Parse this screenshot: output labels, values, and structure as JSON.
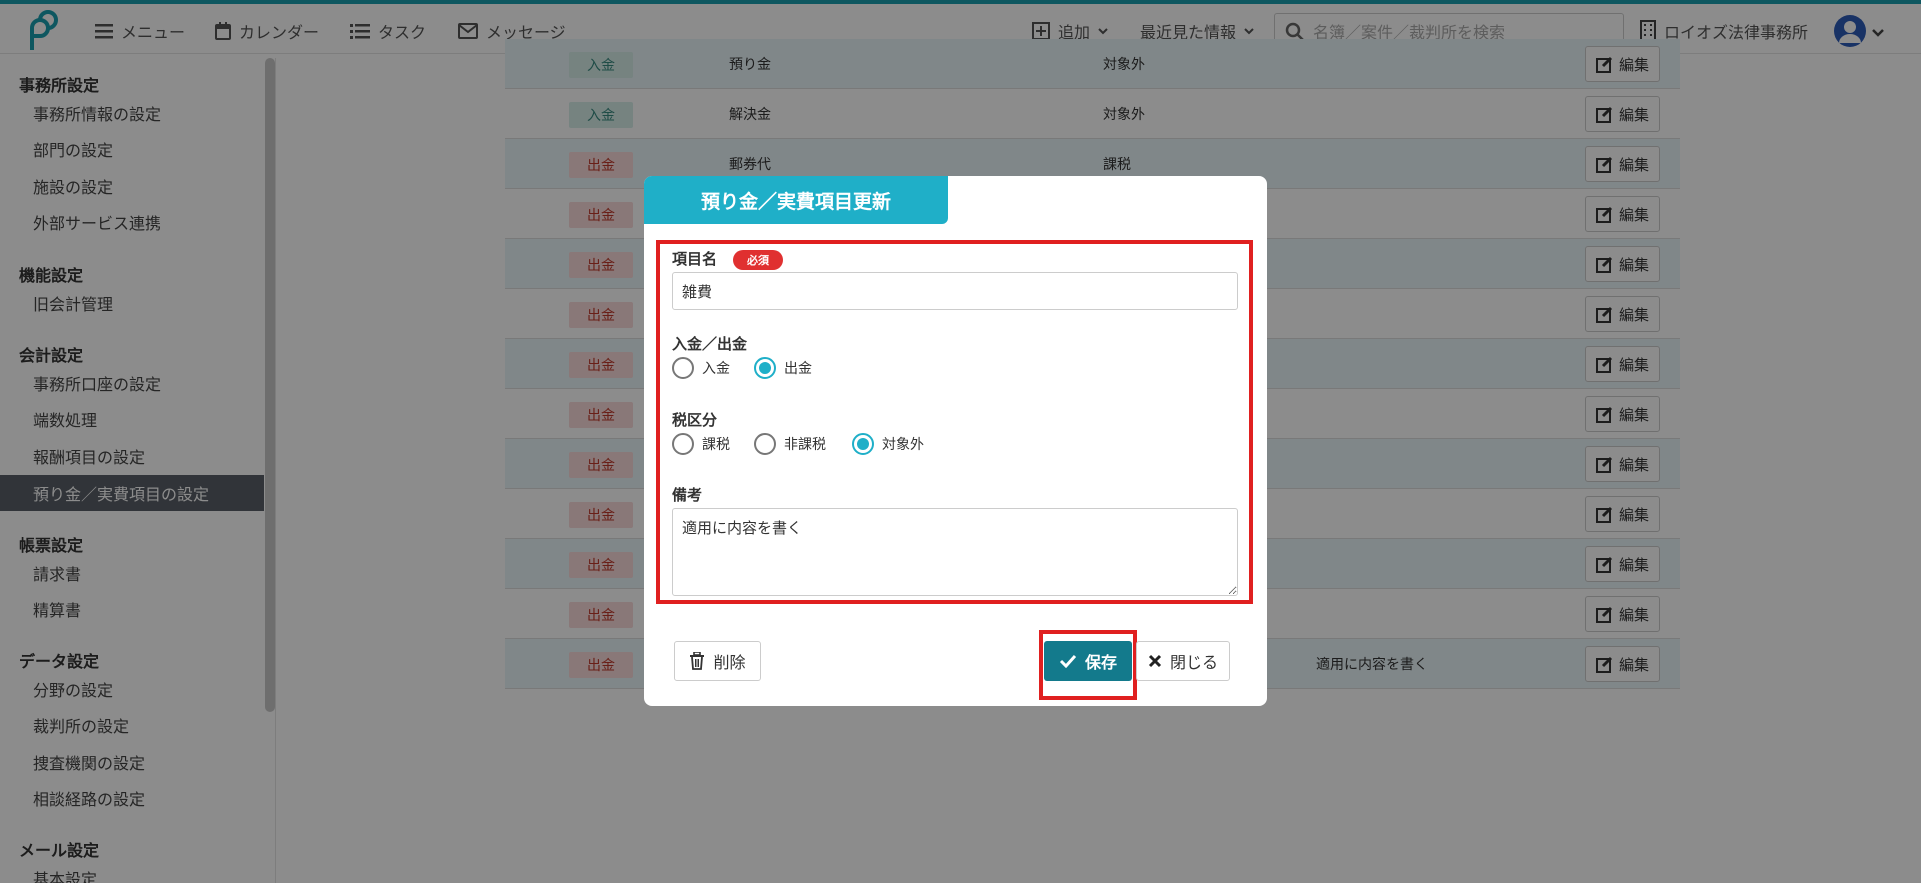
{
  "header": {
    "menu": "メニュー",
    "calendar": "カレンダー",
    "task": "タスク",
    "message": "メッセージ",
    "add": "追加",
    "recent": "最近見た情報",
    "search_placeholder": "名簿／案件／裁判所を検索",
    "office": "ロイオズ法律事務所"
  },
  "sidebar": {
    "groups": [
      {
        "label": "事務所設定",
        "items": [
          "事務所情報の設定",
          "部門の設定",
          "施設の設定",
          "外部サービス連携"
        ]
      },
      {
        "label": "機能設定",
        "items": [
          "旧会計管理"
        ]
      },
      {
        "label": "会計設定",
        "items": [
          "事務所口座の設定",
          "端数処理",
          "報酬項目の設定",
          "預り金／実費項目の設定"
        ]
      },
      {
        "label": "帳票設定",
        "items": [
          "請求書",
          "精算書"
        ]
      },
      {
        "label": "データ設定",
        "items": [
          "分野の設定",
          "裁判所の設定",
          "捜査機関の設定",
          "相談経路の設定"
        ]
      },
      {
        "label": "メール設定",
        "items": [
          "基本設定"
        ]
      }
    ],
    "active_item": "預り金／実費項目の設定"
  },
  "table": {
    "edit_label": "編集",
    "rows": [
      {
        "type": "入金",
        "kind": "in",
        "name": "預り金",
        "tax": "対象外",
        "note": ""
      },
      {
        "type": "入金",
        "kind": "in",
        "name": "解決金",
        "tax": "対象外",
        "note": ""
      },
      {
        "type": "出金",
        "kind": "out",
        "name": "郵券代",
        "tax": "課税",
        "note": ""
      },
      {
        "type": "出金",
        "kind": "out",
        "name": "",
        "tax": "",
        "note": ""
      },
      {
        "type": "出金",
        "kind": "out",
        "name": "",
        "tax": "",
        "note": ""
      },
      {
        "type": "出金",
        "kind": "out",
        "name": "",
        "tax": "",
        "note": ""
      },
      {
        "type": "出金",
        "kind": "out",
        "name": "",
        "tax": "",
        "note": ""
      },
      {
        "type": "出金",
        "kind": "out",
        "name": "",
        "tax": "",
        "note": ""
      },
      {
        "type": "出金",
        "kind": "out",
        "name": "",
        "tax": "",
        "note": ""
      },
      {
        "type": "出金",
        "kind": "out",
        "name": "",
        "tax": "",
        "note": ""
      },
      {
        "type": "出金",
        "kind": "out",
        "name": "",
        "tax": "",
        "note": ""
      },
      {
        "type": "出金",
        "kind": "out",
        "name": "",
        "tax": "",
        "note": ""
      },
      {
        "type": "出金",
        "kind": "out",
        "name": "",
        "tax": "",
        "note": "適用に内容を書く"
      }
    ]
  },
  "modal": {
    "title": "預り金／実費項目更新",
    "item_name_label": "項目名",
    "required_badge": "必須",
    "item_name_value": "雑費",
    "direction_label": "入金／出金",
    "direction_options": [
      "入金",
      "出金"
    ],
    "direction_selected": "出金",
    "tax_label": "税区分",
    "tax_options": [
      "課税",
      "非課税",
      "対象外"
    ],
    "tax_selected": "対象外",
    "note_label": "備考",
    "note_value": "適用に内容を書く",
    "delete_label": "削除",
    "save_label": "保存",
    "close_label": "閉じる"
  },
  "colors": {
    "accent": "#1fafc8",
    "save_button": "#137a8c",
    "highlight": "#e02020",
    "required": "#e03030"
  }
}
